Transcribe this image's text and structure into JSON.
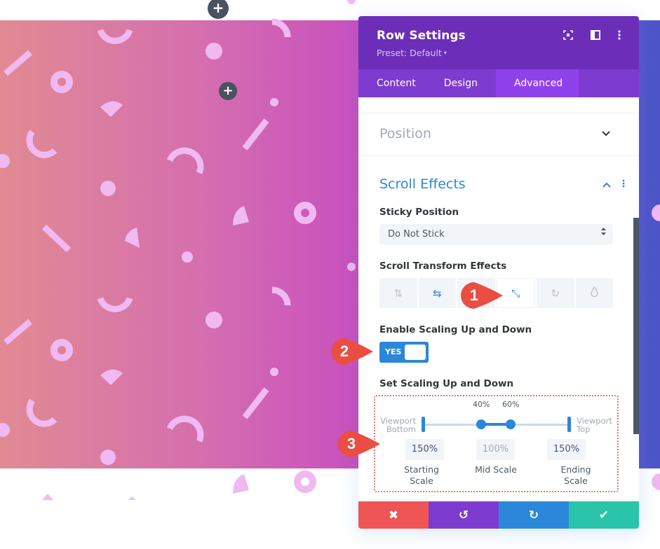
{
  "canvas": {
    "add_buttons": [
      {
        "icon": "plus-icon",
        "label": "+"
      },
      {
        "icon": "plus-icon",
        "label": "+"
      }
    ]
  },
  "panel": {
    "title": "Row Settings",
    "preset": "Preset: Default",
    "preset_caret": "▾",
    "header_icons": [
      "fullscreen-icon",
      "split-view-icon",
      "more-options-icon"
    ],
    "tabs": [
      {
        "label": "Content",
        "active": false
      },
      {
        "label": "Design",
        "active": false
      },
      {
        "label": "Advanced",
        "active": true
      }
    ],
    "sections": {
      "position": {
        "title": "Position",
        "expanded": false,
        "chevron": "⌄"
      },
      "scroll_effects": {
        "title": "Scroll Effects",
        "expanded": true,
        "chevron": "⌃"
      }
    },
    "sticky_position": {
      "label": "Sticky Position",
      "value": "Do Not Stick",
      "arrows": "▲▼"
    },
    "scroll_transform": {
      "label": "Scroll Transform Effects",
      "effects": [
        {
          "name": "vertical-motion",
          "glyph": "⇅",
          "state": "off"
        },
        {
          "name": "horizontal-motion",
          "glyph": "⇆",
          "state": "on"
        },
        {
          "name": "fading",
          "glyph": "",
          "state": "hidden-by-callout"
        },
        {
          "name": "scaling",
          "glyph": "⤡",
          "state": "selected"
        },
        {
          "name": "rotating",
          "glyph": "↻",
          "state": "off"
        },
        {
          "name": "blur",
          "glyph": "💧",
          "state": "off"
        }
      ]
    },
    "enable_scaling": {
      "label": "Enable Scaling Up and Down",
      "toggle_text": "YES",
      "enabled": true
    },
    "set_scaling": {
      "label": "Set Scaling Up and Down",
      "viewport_bottom": [
        "Viewport",
        "Bottom"
      ],
      "viewport_top": [
        "Viewport",
        "Top"
      ],
      "mid_start_pct": "40%",
      "mid_end_pct": "60%",
      "range_start": 40,
      "range_end": 60,
      "starting_scale": {
        "value": "150%",
        "label": [
          "Starting",
          "Scale"
        ]
      },
      "mid_scale": {
        "value": "100%",
        "label": [
          "Mid Scale"
        ]
      },
      "ending_scale": {
        "value": "150%",
        "label": [
          "Ending",
          "Scale"
        ]
      }
    },
    "footer": [
      {
        "name": "cancel",
        "glyph": "✖",
        "color": "#ef5555"
      },
      {
        "name": "undo",
        "glyph": "↺",
        "color": "#7e3bd0"
      },
      {
        "name": "redo",
        "glyph": "↻",
        "color": "#2b87da"
      },
      {
        "name": "save",
        "glyph": "✔",
        "color": "#29c4a9"
      }
    ]
  },
  "callouts": [
    {
      "number": "1",
      "color": "#ea4e42"
    },
    {
      "number": "2",
      "color": "#ea4e42"
    },
    {
      "number": "3",
      "color": "#ea4e42"
    }
  ],
  "colors": {
    "header": "#6c2eb9",
    "tabs": "#7e3bd0",
    "active_tab": "#8f42ec",
    "accent": "#2b87da",
    "shape": "#f0b9f2"
  }
}
